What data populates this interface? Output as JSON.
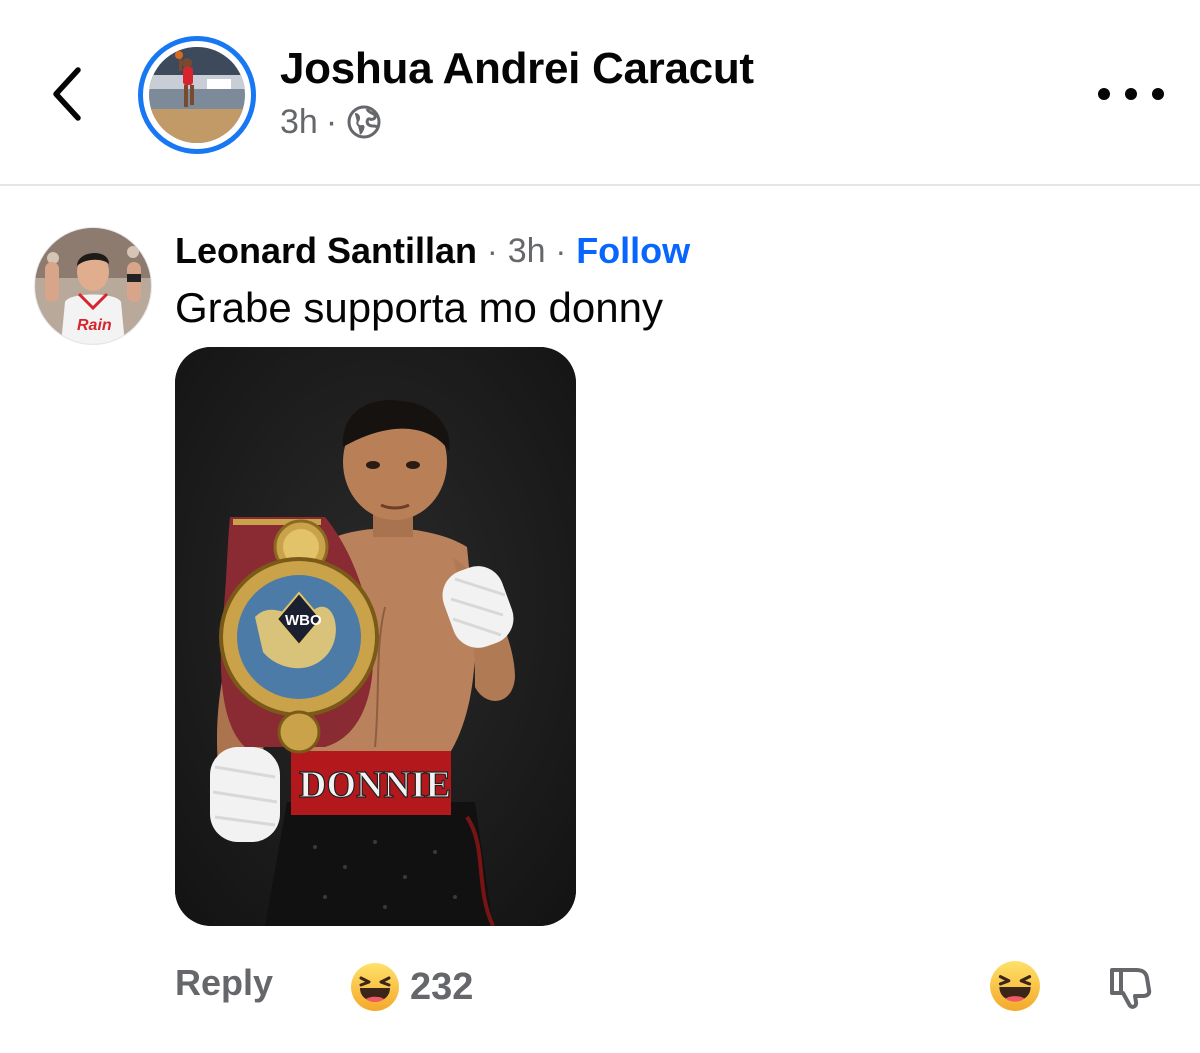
{
  "header": {
    "back_icon": "chevron-left-icon",
    "author_name": "Joshua Andrei Caracut",
    "post_time": "3h",
    "separator": "·",
    "audience_icon": "globe-icon",
    "more_icon": "more-horizontal-icon",
    "accent_color": "#1877f2"
  },
  "comment": {
    "author_name": "Leonard Santillan",
    "separator": "·",
    "time": "3h",
    "follow_label": "Follow",
    "follow_color": "#0866ff",
    "text": "Grabe supporta mo donny",
    "photo": {
      "trunks_text": "DONNIE",
      "belt_text": "WBO"
    }
  },
  "actions": {
    "reply_label": "Reply",
    "reaction_icon": "haha-emoji-icon",
    "reaction_count": "232",
    "react_icon": "haha-emoji-icon",
    "dislike_icon": "thumbs-down-icon"
  }
}
